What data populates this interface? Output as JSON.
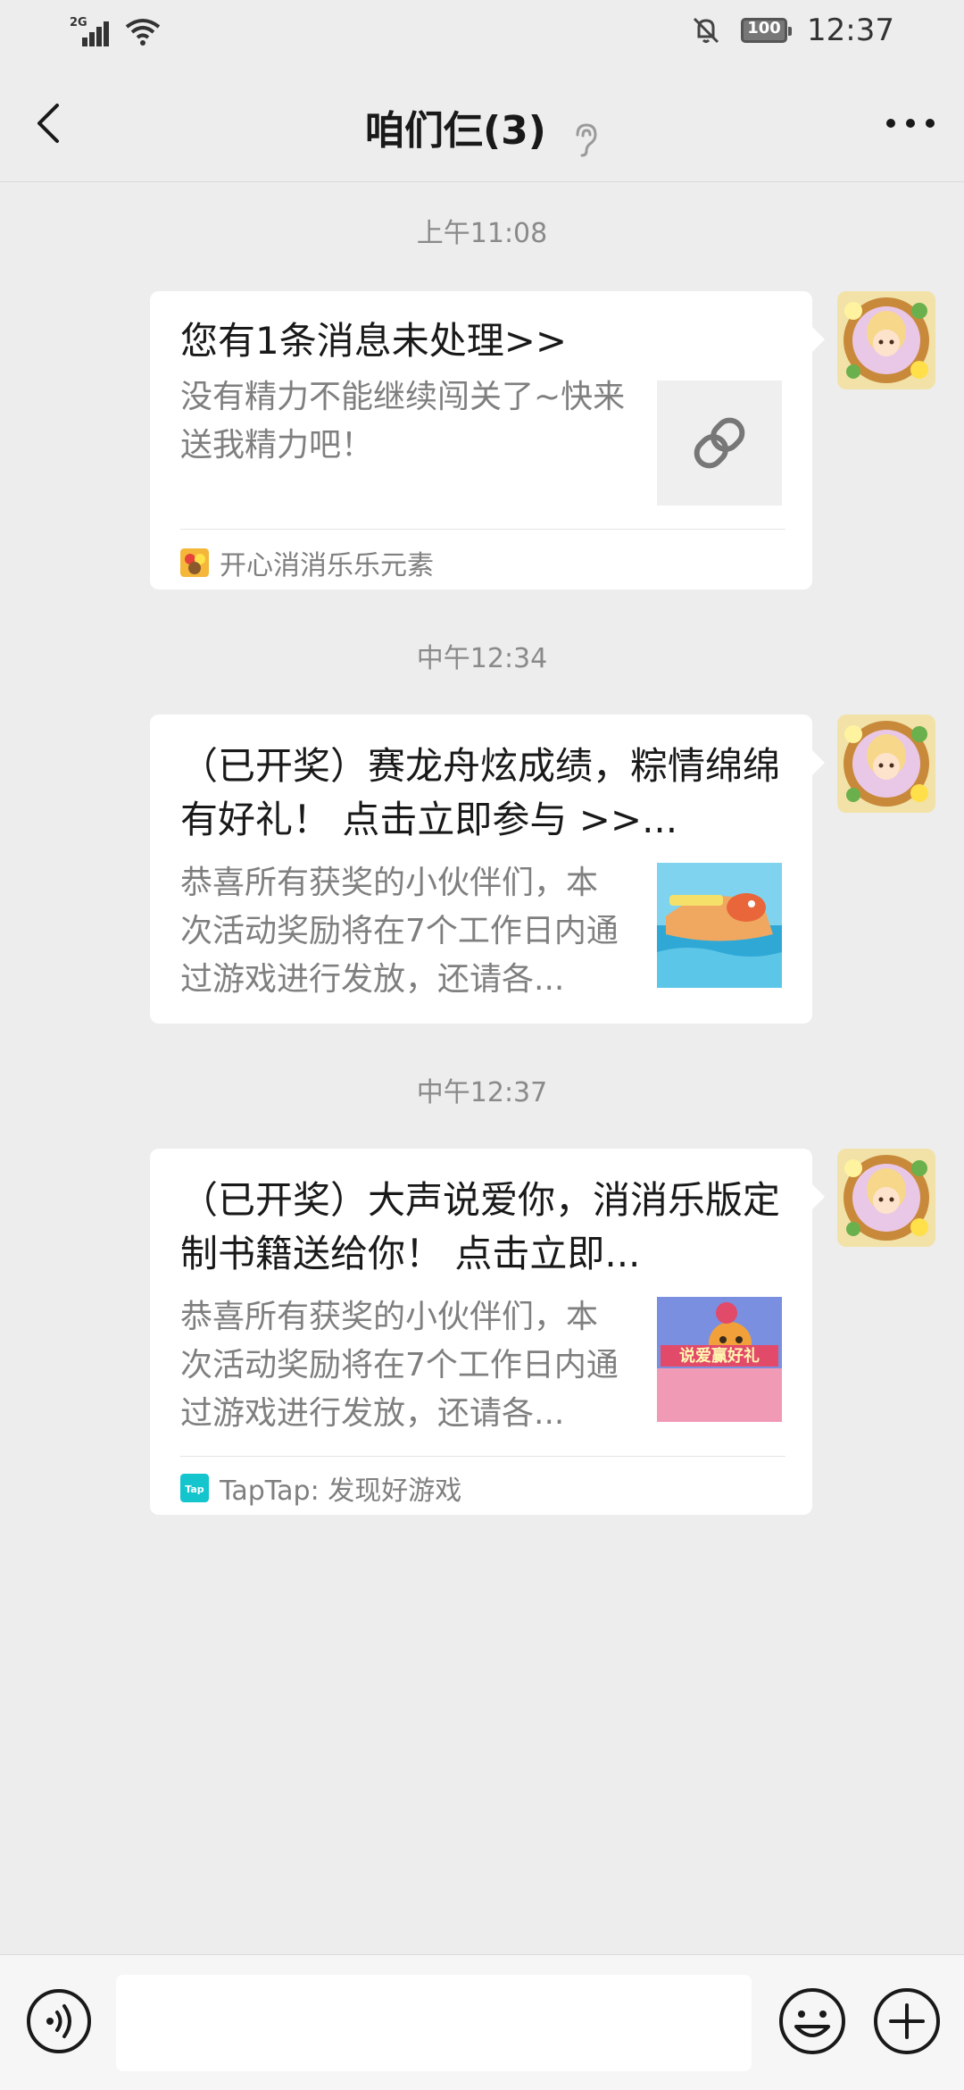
{
  "status_bar": {
    "network_label": "2G",
    "battery_level": "100",
    "time": "12:37"
  },
  "header": {
    "back_icon": "chevron-left-icon",
    "title": "咱们仨(3)",
    "earpiece_icon": "ear-icon",
    "more_icon": "more-dots-icon"
  },
  "messages": [
    {
      "timestamp": "上午11:08",
      "title": "您有1条消息未处理>>",
      "description": "没有精力不能继续闯关了~快来送我精力吧！",
      "thumbnail": "link-icon",
      "source": "开心消消乐乐元素"
    },
    {
      "timestamp": "中午12:34",
      "title": "（已开奖）赛龙舟炫成绩，粽情绵绵有好礼！ 点击立即参与 >>...",
      "description": "恭喜所有获奖的小伙伴们，本次活动奖励将在7个工作日内通过游戏进行发放，还请各...",
      "thumbnail": "dragon-boat-image",
      "source": ""
    },
    {
      "timestamp": "中午12:37",
      "title": "（已开奖）大声说爱你，消消乐版定制书籍送给你！ 点击立即...",
      "description": "恭喜所有获奖的小伙伴们，本次活动奖励将在7个工作日内通过游戏进行发放，还请各...",
      "thumbnail": "promo-image",
      "thumbnail_text": "说爱赢好礼",
      "source": "TapTap: 发现好游戏"
    }
  ],
  "input_bar": {
    "voice_icon": "voice-icon",
    "message_placeholder": "",
    "emoji_icon": "emoji-icon",
    "plus_icon": "plus-icon"
  },
  "colors": {
    "background": "#ededed",
    "card": "#ffffff",
    "muted_text": "#7f7f7f",
    "primary_text": "#191919"
  }
}
